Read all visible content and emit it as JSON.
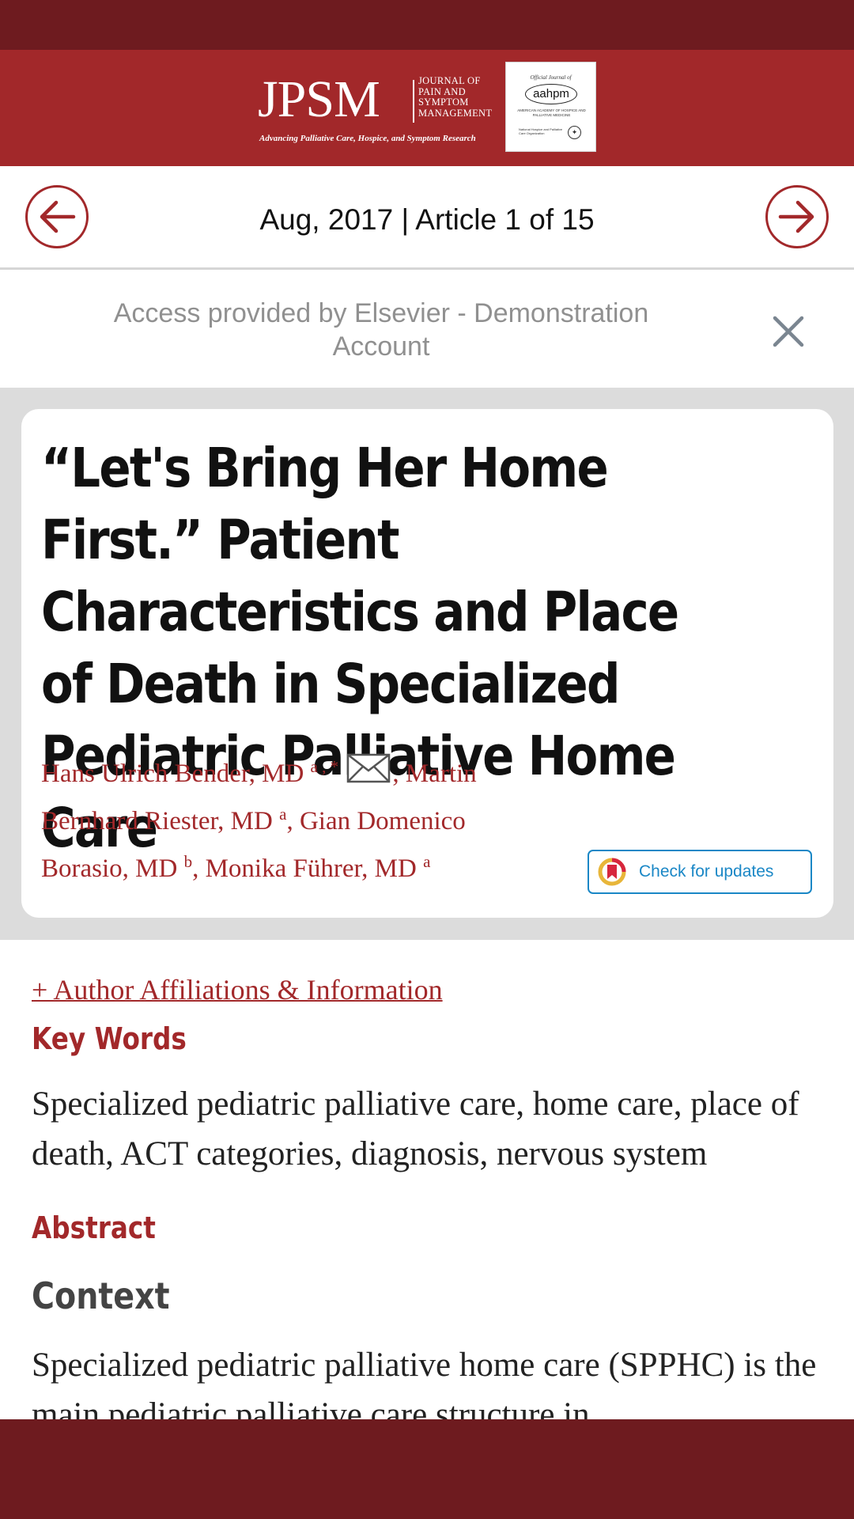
{
  "journal": {
    "logo_letters": "JPSM",
    "full_name": "Journal of Pain and Symptom Management",
    "tagline": "Advancing Palliative Care, Hospice, and Symptom Research",
    "partner": {
      "official_journal_of": "Official Journal of",
      "name": "aahpm",
      "subtitle": "American Academy of Hospice and Palliative Medicine",
      "npco": "National Hospice and Palliative Care Organization"
    }
  },
  "issue_nav": {
    "label": "Aug, 2017 | Article 1 of 15",
    "prev_icon": "arrow-left-icon",
    "next_icon": "arrow-right-icon"
  },
  "access_banner": {
    "text": "Access provided by Elsevier - Demonstration Account",
    "close_icon": "close-icon"
  },
  "article": {
    "title": "“Let's Bring Her Home First.” Patient Characteristics and Place of Death in Specialized Pediatric Palliative Home Care",
    "authors": [
      {
        "name": "Hans Ulrich Bender, MD",
        "sup": "a , *"
      },
      {
        "name": "Martin Bernhard Riester, MD",
        "sup": "a"
      },
      {
        "name": "Gian Domenico Borasio, MD",
        "sup": "b"
      },
      {
        "name": "Monika Führer, MD",
        "sup": "a"
      }
    ],
    "separator": ", ",
    "check_updates_label": "Check for updates",
    "affiliations_link": "+ Author Affiliations & Information",
    "keywords_heading": "Key Words",
    "keywords": "Specialized pediatric palliative care, home care, place of death, ACT categories, diagnosis, nervous system",
    "abstract_heading": "Abstract",
    "context_heading": "Context",
    "context_text": "Specialized pediatric palliative home care (SPPHC) is the main pediatric palliative care structure in"
  },
  "colors": {
    "brand_red": "#a2282a",
    "dark_red": "#6e1b1f",
    "link_blue": "#1a87c6",
    "card_background": "#dcdcdc"
  }
}
